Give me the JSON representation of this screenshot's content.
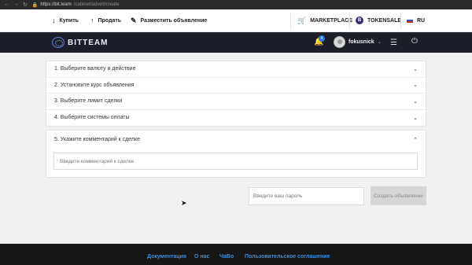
{
  "browser": {
    "url_host": "https://bit.team",
    "url_path": "/cabinet/advert/create"
  },
  "topbar": {
    "buy": "Купить",
    "sell": "Продать",
    "place_ad": "Разместить объявление",
    "marketplace": "MARKETPLACE",
    "tokensale": "TOKENSALE",
    "tokensale_badge": "B",
    "language": "RU"
  },
  "header": {
    "logo_text": "BITTEAM",
    "notifications_count": "4",
    "username": "fokusnick"
  },
  "accordion": {
    "steps": [
      "1. Выберите валюту и действие",
      "2. Установите курс объявления",
      "3. Выберите лимит сделки",
      "4. Выберите системы оплаты"
    ],
    "comment_step": "5. Укажите комментарий к сделке",
    "comment_placeholder": "Введите комментарий к сделке"
  },
  "form": {
    "password_placeholder": "Введите ваш пароль",
    "create_button": "Создать объявление"
  },
  "footer": {
    "links": [
      "Документация",
      "О нас",
      "ЧаВо",
      "Пользовательское соглашение"
    ]
  },
  "colors": {
    "header_bg": "#1c1f2a",
    "footer_link": "#3a8fe3",
    "badge": "#2d7bd8"
  }
}
